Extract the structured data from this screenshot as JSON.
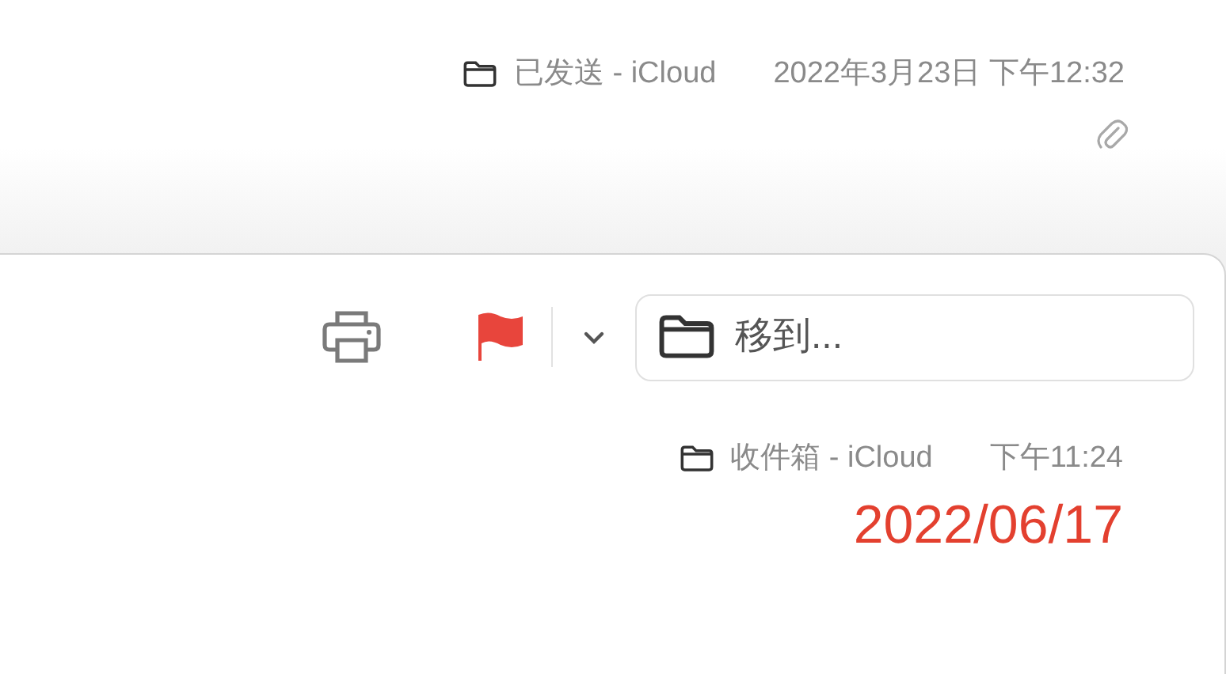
{
  "previous_message": {
    "mailbox": "已发送 - iCloud",
    "date": "2022年3月23日 下午12:32",
    "has_attachment": true
  },
  "toolbar": {
    "flagged": true,
    "move_button": {
      "label": "移到..."
    }
  },
  "message": {
    "mailbox": "收件箱 - iCloud",
    "time": "下午11:24",
    "date_note": "2022/06/17"
  }
}
